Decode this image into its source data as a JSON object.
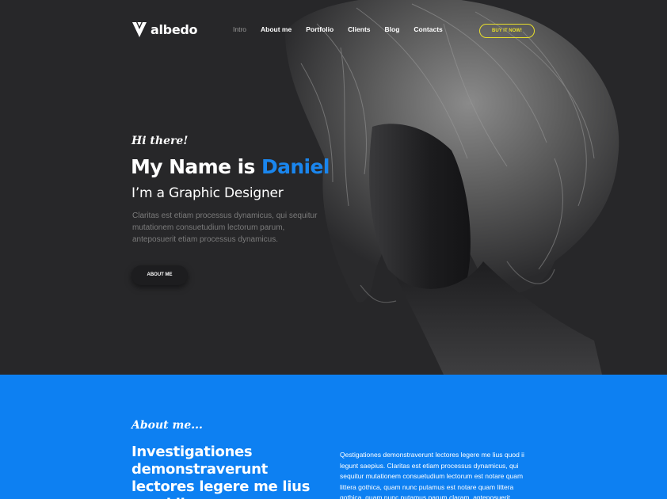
{
  "nav": {
    "logo_text": "albedo",
    "items": [
      "Intro",
      "About me",
      "Portfolio",
      "Clients",
      "Blog",
      "Contacts"
    ],
    "buy_label": "BUY IT NOW!"
  },
  "hero": {
    "greeting": "Hi there!",
    "name_prefix": "My Name is ",
    "name_highlight": "Daniel",
    "role": "I’m a Graphic Designer",
    "description": "Claritas est etiam processus dynamicus, qui sequitur mutationem consuetudium lectorum parum, anteposuerit etiam processus dynamicus.",
    "button_label": "ABOUT ME"
  },
  "about": {
    "title": "About me...",
    "headline": "Investigationes demonstraverunt lectores legere me lius quod ii",
    "paragraph": "Qestigationes demonstraverunt lectores legere me lius quod ii legunt saepius. Claritas est etiam processus dynamicus, qui sequitur mutationem consuetudium lectorum est notare quam littera gothica, quam nunc putamus est notare quam littera gothica, quam nunc putamus parum claram, anteposuerit litterarum"
  },
  "colors": {
    "accent_blue": "#0d80f2",
    "highlight_blue": "#1a86ee",
    "buy_yellow": "#e8de2c",
    "hero_bg": "#272729"
  },
  "icons": {
    "logo": "albedo-v-logo-icon"
  }
}
